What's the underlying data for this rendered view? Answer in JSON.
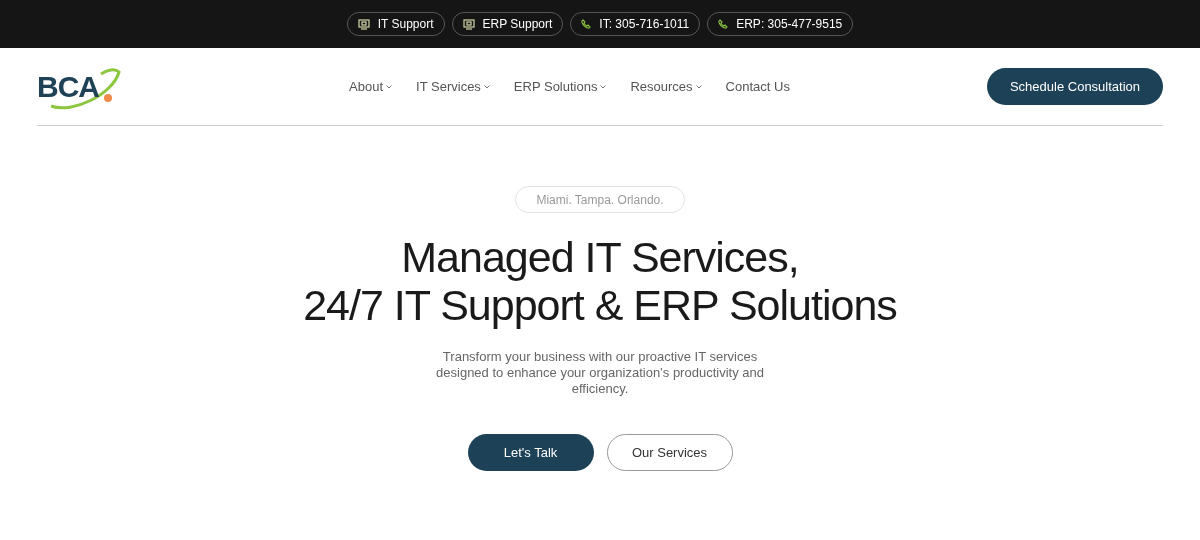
{
  "top_bar": {
    "links": [
      {
        "kind": "support",
        "label": "IT Support"
      },
      {
        "kind": "support",
        "label": "ERP Support"
      },
      {
        "kind": "phone",
        "label": "IT: 305-716-1011"
      },
      {
        "kind": "phone",
        "label": "ERP: 305-477-9515"
      }
    ]
  },
  "header": {
    "logo": "BCA",
    "nav": [
      {
        "label": "About",
        "dropdown": true
      },
      {
        "label": "IT Services",
        "dropdown": true
      },
      {
        "label": "ERP Solutions",
        "dropdown": true
      },
      {
        "label": "Resources",
        "dropdown": true
      },
      {
        "label": "Contact Us",
        "dropdown": false
      }
    ],
    "cta": "Schedule Consultation"
  },
  "hero": {
    "badge": "Miami. Tampa. Orlando.",
    "title_lines": [
      "Managed IT Services,",
      "24/7 IT Support & ERP Solutions"
    ],
    "subtitle": "Transform your business with our proactive IT services designed to enhance your organization’s productivity and efficiency.",
    "buttons": [
      {
        "label": "Let's Talk",
        "kind": "primary"
      },
      {
        "label": "Our Services",
        "kind": "outline"
      }
    ]
  }
}
